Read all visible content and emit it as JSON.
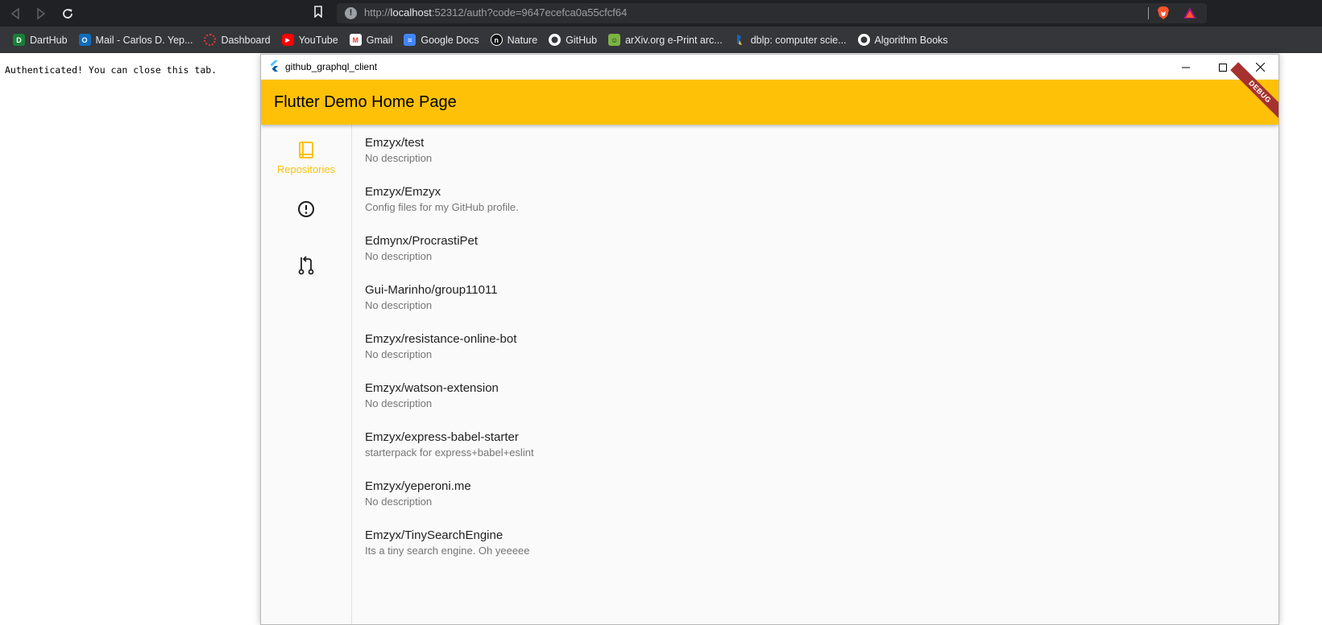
{
  "browser": {
    "url_prefix": "http://",
    "url_host": "localhost",
    "url_rest": ":52312/auth?code=9647ecefca0a55cfcf64",
    "bookmarks": [
      {
        "label": "DartHub",
        "icon": "darthub-icon",
        "color": "#1a7f37",
        "glyph": "D"
      },
      {
        "label": "Mail - Carlos D. Yep...",
        "icon": "outlook-icon",
        "color": "#0f6cbd",
        "glyph": "O"
      },
      {
        "label": "Dashboard",
        "icon": "dashboard-icon",
        "color": "#e53935",
        "glyph": ""
      },
      {
        "label": "YouTube",
        "icon": "youtube-icon",
        "color": "#ff0000",
        "glyph": "▶"
      },
      {
        "label": "Gmail",
        "icon": "gmail-icon",
        "color": "#ea4335",
        "glyph": "M"
      },
      {
        "label": "Google Docs",
        "icon": "google-docs-icon",
        "color": "#4285f4",
        "glyph": "≡"
      },
      {
        "label": "Nature",
        "icon": "nature-icon",
        "color": "#111111",
        "glyph": "n"
      },
      {
        "label": "GitHub",
        "icon": "github-icon",
        "color": "#ffffff",
        "glyph": ""
      },
      {
        "label": "arXiv.org e-Print arc...",
        "icon": "arxiv-icon",
        "color": "#7cb342",
        "glyph": "☺"
      },
      {
        "label": "dblp: computer scie...",
        "icon": "dblp-icon",
        "color": "#1565c0",
        "glyph": ""
      },
      {
        "label": "Algorithm Books",
        "icon": "github-icon",
        "color": "#ffffff",
        "glyph": ""
      }
    ]
  },
  "page": {
    "message": "Authenticated! You can close this tab."
  },
  "window": {
    "title": "github_graphql_client"
  },
  "app": {
    "title": "Flutter Demo Home Page",
    "debug_banner": "DEBUG",
    "accent": "#ffc107",
    "rail": {
      "repositories_label": "Repositories"
    },
    "repos": [
      {
        "name": "Emzyx/test",
        "description": "No description"
      },
      {
        "name": "Emzyx/Emzyx",
        "description": "Config files for my GitHub profile."
      },
      {
        "name": "Edmynx/ProcrastiPet",
        "description": "No description"
      },
      {
        "name": "Gui-Marinho/group11011",
        "description": "No description"
      },
      {
        "name": "Emzyx/resistance-online-bot",
        "description": "No description"
      },
      {
        "name": "Emzyx/watson-extension",
        "description": "No description"
      },
      {
        "name": "Emzyx/express-babel-starter",
        "description": "starterpack for express+babel+eslint"
      },
      {
        "name": "Emzyx/yeperoni.me",
        "description": "No description"
      },
      {
        "name": "Emzyx/TinySearchEngine",
        "description": "Its a tiny search engine. Oh yeeeee"
      }
    ]
  }
}
